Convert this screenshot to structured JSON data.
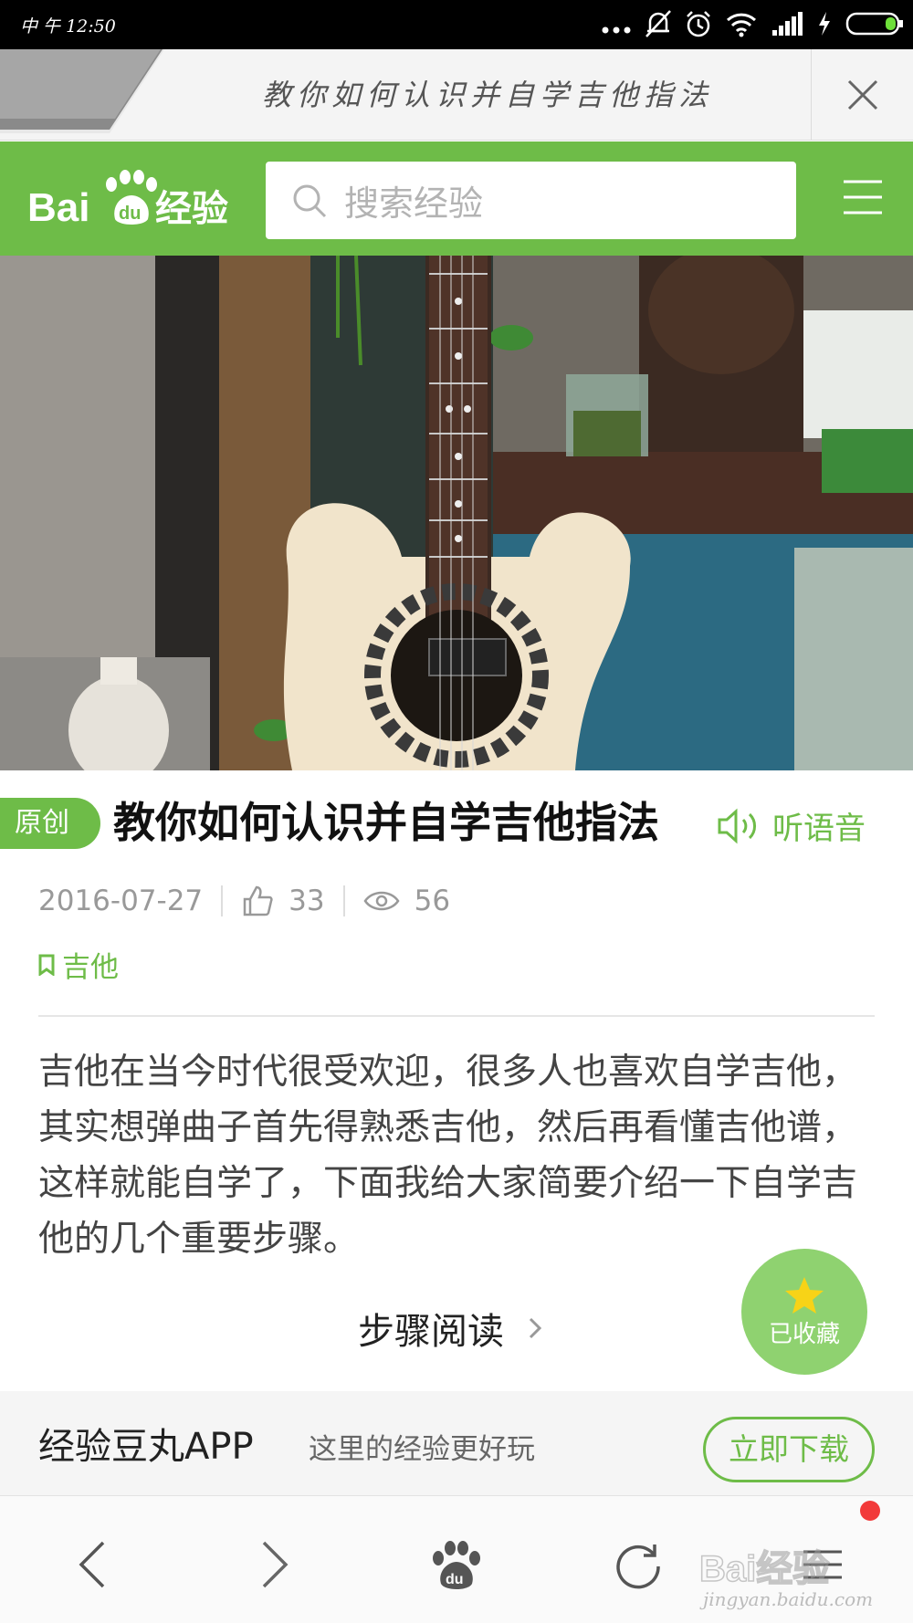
{
  "status_bar": {
    "time": "中 午 12:50"
  },
  "title_bar": {
    "title": "教你如何认识并自学吉他指法"
  },
  "header": {
    "logo_text": "Bai",
    "logo_text_du": "du",
    "logo_text_cn": "经验",
    "search_placeholder": "搜索经验"
  },
  "article": {
    "badge": "原创",
    "title": "教你如何认识并自学吉他指法",
    "listen_label": "听语音",
    "date": "2016-07-27",
    "likes": "33",
    "views": "56",
    "tag": "吉他",
    "intro": "吉他在当今时代很受欢迎，很多人也喜欢自学吉他，其实想弹曲子首先得熟悉吉他，然后再看懂吉他谱，这样就能自学了，下面我给大家简要介绍一下自学吉他的几个重要步骤。",
    "read_steps": "步骤阅读",
    "favorited_label": "已收藏"
  },
  "app_banner": {
    "name": "经验豆丸APP",
    "slogan": "这里的经验更好玩",
    "download": "立即下载"
  },
  "watermark": {
    "text": "jingyan.baidu.com",
    "logo": "Bai经验"
  },
  "colors": {
    "brand_green": "#6ebc48",
    "fav_green": "#8fd270",
    "notif_red": "#f23a3a"
  }
}
